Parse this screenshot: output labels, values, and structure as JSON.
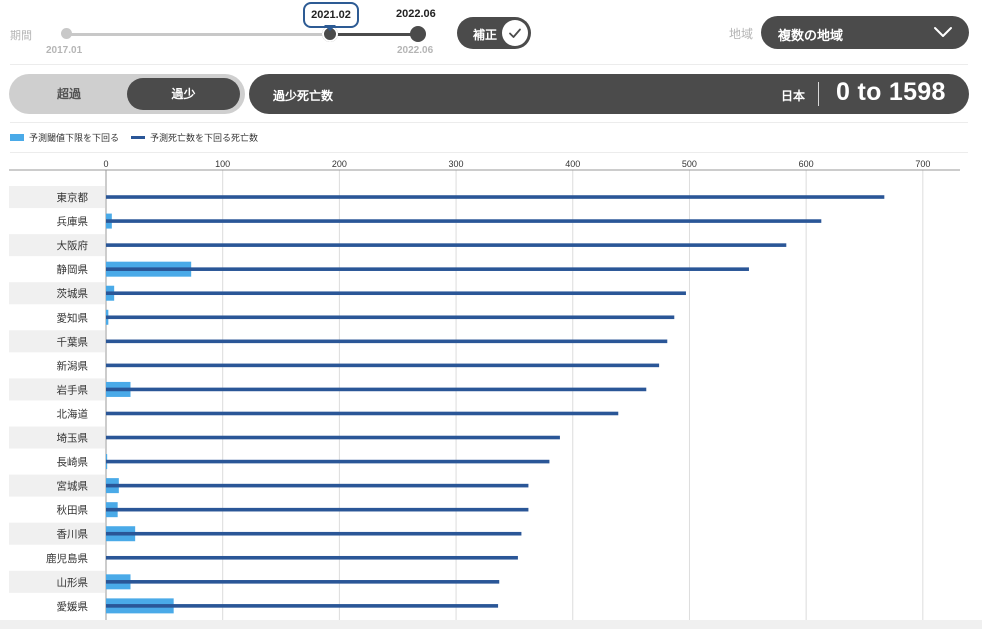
{
  "filters": {
    "period_label": "期間",
    "period_start": "2017.01",
    "period_selected": "2021.02",
    "period_end": "2022.06",
    "period_max": "2022.06",
    "correction_label": "補正",
    "region_label": "地域",
    "region_value": "複数の地域"
  },
  "mode": {
    "excess_label": "超過",
    "deficit_label": "過少",
    "active": "deficit"
  },
  "metric": {
    "title": "過少死亡数",
    "country": "日本",
    "range": "0 to 1598"
  },
  "colors": {
    "threshold_bar": "#4aaae8",
    "deaths_line": "#2a5697",
    "dark": "#4b4b4b"
  },
  "chart_data": {
    "type": "bar",
    "orientation": "horizontal",
    "x_ticks": [
      0,
      100,
      200,
      300,
      400,
      500,
      600,
      700
    ],
    "xlim": [
      0,
      730
    ],
    "grid": true,
    "legend_position": "top-left",
    "categories": [
      "東京都",
      "兵庫県",
      "大阪府",
      "静岡県",
      "茨城県",
      "愛知県",
      "千葉県",
      "新潟県",
      "岩手県",
      "北海道",
      "埼玉県",
      "長崎県",
      "宮城県",
      "秋田県",
      "香川県",
      "鹿児島県",
      "山形県",
      "愛媛県"
    ],
    "series": [
      {
        "name": "予測閾値下限を下回る",
        "style": "thick-bar",
        "values": [
          0,
          5,
          0,
          73,
          7,
          2,
          0,
          0,
          21,
          0,
          0,
          1,
          11,
          10,
          25,
          0,
          21,
          58
        ]
      },
      {
        "name": "予測死亡数を下回る死亡数",
        "style": "line",
        "values": [
          667,
          613,
          583,
          551,
          497,
          487,
          481,
          474,
          463,
          439,
          389,
          380,
          362,
          362,
          356,
          353,
          337,
          336
        ]
      }
    ]
  }
}
